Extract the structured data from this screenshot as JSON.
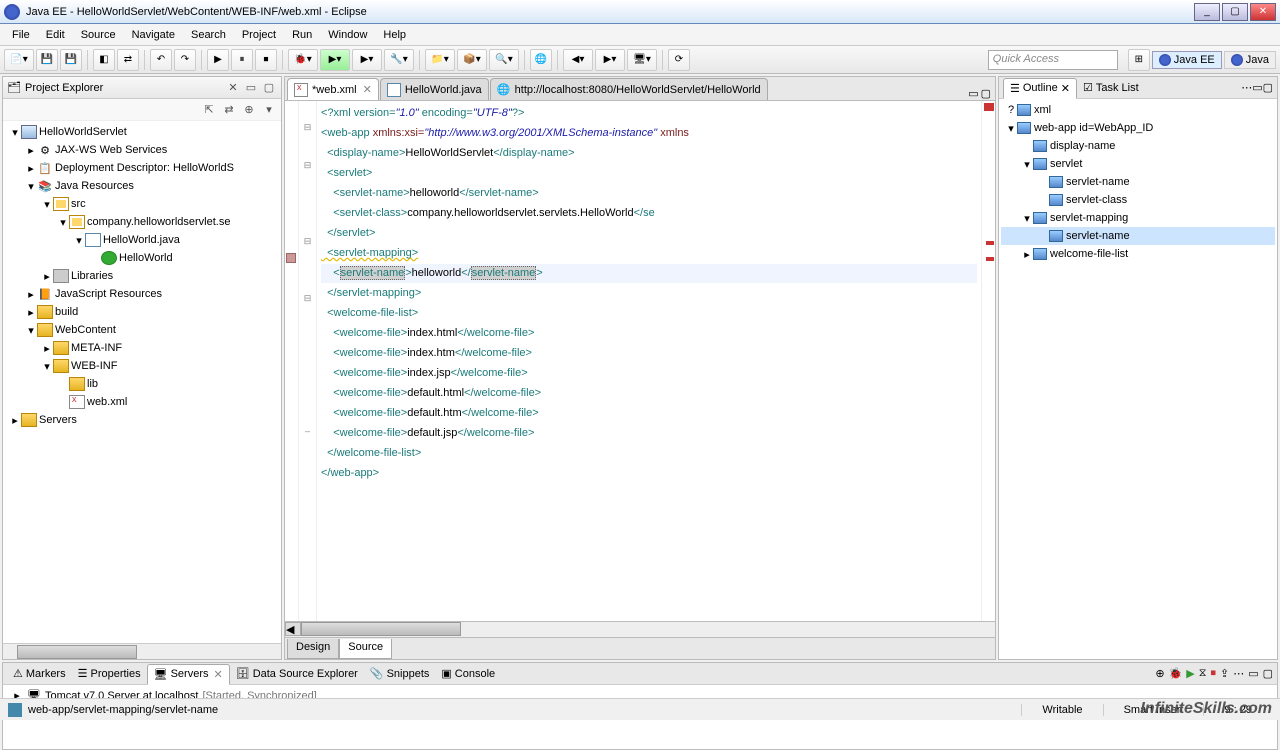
{
  "title": "Java EE - HelloWorldServlet/WebContent/WEB-INF/web.xml - Eclipse",
  "menus": [
    "File",
    "Edit",
    "Source",
    "Navigate",
    "Search",
    "Project",
    "Run",
    "Window",
    "Help"
  ],
  "quick_access": "Quick Access",
  "perspectives": {
    "javaee": "Java EE",
    "java": "Java"
  },
  "project_explorer": {
    "title": "Project Explorer",
    "tree": {
      "project": "HelloWorldServlet",
      "jaxws": "JAX-WS Web Services",
      "depdesc": "Deployment Descriptor: HelloWorldS",
      "javares": "Java Resources",
      "src": "src",
      "pkg": "company.helloworldservlet.se",
      "cls_java": "HelloWorld.java",
      "cls": "HelloWorld",
      "libs": "Libraries",
      "jsres": "JavaScript Resources",
      "build": "build",
      "webcontent": "WebContent",
      "metainf": "META-INF",
      "webinf": "WEB-INF",
      "lib": "lib",
      "webxml": "web.xml",
      "servers": "Servers"
    }
  },
  "editor": {
    "tabs": {
      "webxml": "*web.xml",
      "hello": "HelloWorld.java",
      "url": "http://localhost:8080/HelloWorldServlet/HelloWorld"
    },
    "sub_tabs": {
      "design": "Design",
      "source": "Source"
    },
    "code": {
      "l1_pre": "<?xml version=",
      "l1_v": "\"1.0\"",
      "l1_mid": " encoding=",
      "l1_enc": "\"UTF-8\"",
      "l1_end": "?>",
      "l2_pre": "<web-app ",
      "l2_attr": "xmlns:xsi=",
      "l2_val": "\"http://www.w3.org/2001/XMLSchema-instance\"",
      "l2_end": " xmlns",
      "l3_o": "  <display-name>",
      "l3_t": "HelloWorldServlet",
      "l3_c": "</display-name>",
      "l4": "  <servlet>",
      "l5_o": "    <servlet-name>",
      "l5_t": "helloworld",
      "l5_c": "</servlet-name>",
      "l6_o": "    <servlet-class>",
      "l6_t": "company.helloworldservlet.servlets.HelloWorld",
      "l6_c": "</se",
      "l7": "  </servlet>",
      "l8": "  <servlet-mapping>",
      "l9_o": "    <",
      "l9_ot": "servlet-name",
      "l9_oc": ">",
      "l9_t": "helloworld",
      "l9_cur": "|",
      "l9_co": "</",
      "l9_ct": "servlet-name",
      "l9_cc": ">",
      "l10": "  </servlet-mapping>",
      "l11": "  <welcome-file-list>",
      "l12_o": "    <welcome-file>",
      "l12_t": "index.html",
      "l12_c": "</welcome-file>",
      "l13_o": "    <welcome-file>",
      "l13_t": "index.htm",
      "l13_c": "</welcome-file>",
      "l14_o": "    <welcome-file>",
      "l14_t": "index.jsp",
      "l14_c": "</welcome-file>",
      "l15_o": "    <welcome-file>",
      "l15_t": "default.html",
      "l15_c": "</welcome-file>",
      "l16_o": "    <welcome-file>",
      "l16_t": "default.htm",
      "l16_c": "</welcome-file>",
      "l17_o": "    <welcome-file>",
      "l17_t": "default.jsp",
      "l17_c": "</welcome-file>",
      "l18": "  </welcome-file-list>",
      "l19": "</web-app>"
    }
  },
  "bottom": {
    "tabs": {
      "markers": "Markers",
      "properties": "Properties",
      "servers": "Servers",
      "dse": "Data Source Explorer",
      "snippets": "Snippets",
      "console": "Console"
    },
    "server_name": "Tomcat v7.0 Server at localhost",
    "server_status": "[Started, Synchronized]"
  },
  "outline": {
    "tabs": {
      "outline": "Outline",
      "tasklist": "Task List"
    },
    "tree": {
      "xml": "xml",
      "webapp": "web-app id=WebApp_ID",
      "dname": "display-name",
      "servlet": "servlet",
      "sname1": "servlet-name",
      "sclass": "servlet-class",
      "smap": "servlet-mapping",
      "sname2": "servlet-name",
      "wfl": "welcome-file-list"
    }
  },
  "status": {
    "path": "web-app/servlet-mapping/servlet-name",
    "writable": "Writable",
    "insert": "Smart Insert",
    "pos": "9 : 29"
  },
  "watermark": "InfiniteSkills.com"
}
